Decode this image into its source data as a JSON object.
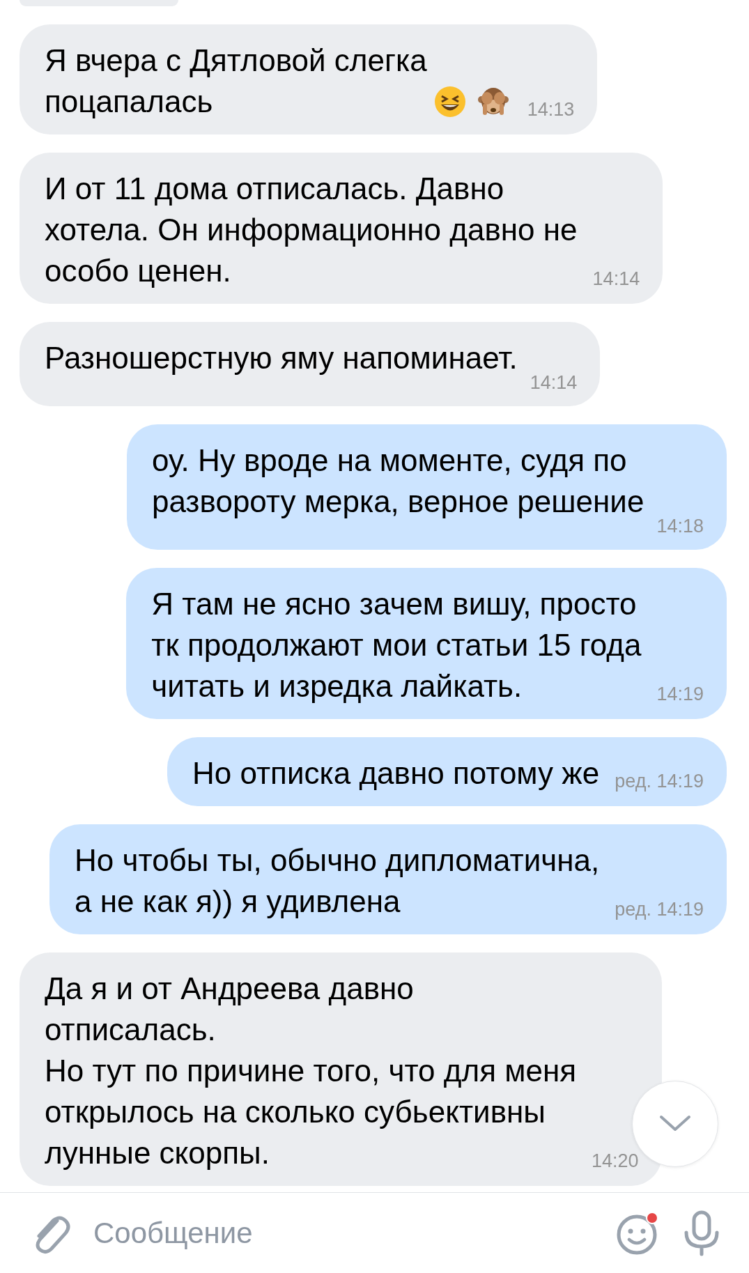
{
  "messages": [
    {
      "kind": "cut",
      "outgoing": false
    },
    {
      "kind": "text_with_emoji",
      "outgoing": false,
      "text": "Я вчера с Дятловой слегка\nпоцапалась",
      "time": "14:13"
    },
    {
      "kind": "text",
      "outgoing": false,
      "text": "И от 11 дома отписалась. Давно\nхотела. Он информационно давно не\nособо ценен.",
      "time": "14:14"
    },
    {
      "kind": "text",
      "outgoing": false,
      "text": "Разношерстную яму напоминает.",
      "time": "14:14",
      "time_below": true
    },
    {
      "kind": "text",
      "outgoing": true,
      "text": "оу. Ну вроде на моменте, судя по\nразвороту мерка, верное решение",
      "time": "14:18",
      "time_below": true
    },
    {
      "kind": "text",
      "outgoing": true,
      "text": "Я там не ясно зачем вишу, просто\nтк продолжают мои статьи 15 года\nчитать и изредка лайкать.",
      "time": "14:19"
    },
    {
      "kind": "text",
      "outgoing": true,
      "text": "Но отписка давно потому же",
      "time": "ред. 14:19"
    },
    {
      "kind": "text",
      "outgoing": true,
      "text": "Но чтобы ты, обычно дипломатична,\nа не как я)) я удивлена",
      "time": "ред. 14:19"
    },
    {
      "kind": "text",
      "outgoing": false,
      "text": "Да я и от Андреева давно\nотписалась.\nНо тут по причине того, что для меня\nоткрылось на сколько субьективны\nлунные скорпы.",
      "time": "14:20"
    }
  ],
  "composer": {
    "placeholder": "Сообщение",
    "emoji_badge": true
  }
}
